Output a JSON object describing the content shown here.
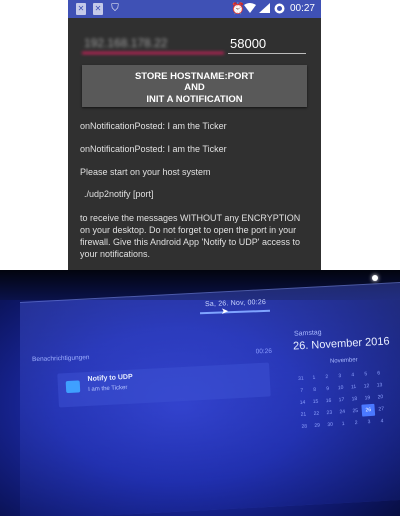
{
  "status_bar": {
    "left_icons": [
      "notification-x-icon",
      "notification-x-icon",
      "shield-icon"
    ],
    "right_icons": [
      "alarm-icon",
      "wifi-icon",
      "signal-icon",
      "battery-icon"
    ],
    "time": "00:27",
    "color": "#3f51b5"
  },
  "form": {
    "host_value": "192.168.178.22",
    "port_value": "58000",
    "button_lines": [
      "STORE HOSTNAME:PORT",
      "AND",
      "INIT A NOTIFICATION"
    ],
    "accent": "#e91e63"
  },
  "log_lines": [
    "onNotificationPosted: I am the Ticker",
    "onNotificationPosted: I am the Ticker",
    "Please start on your host system",
    "./udp2notify [port]",
    "to receive the messages WITHOUT any ENCRYPTION on your desktop. Do not forget to open the port in your firewall. Give this Android App 'Notify to UDP' access to your notifications."
  ],
  "desktop": {
    "clock": "Sa, 26. Nov, 00:26",
    "notifications_header": "Benachrichtigungen",
    "notifications_time": "00:26",
    "notification": {
      "title": "Notify to UDP",
      "body": "I am the Ticker"
    },
    "calendar": {
      "weekday": "Samstag",
      "date": "26. November 2016",
      "month": "November",
      "weeks": [
        [
          "31",
          "1",
          "2",
          "3",
          "4",
          "5",
          "6"
        ],
        [
          "7",
          "8",
          "9",
          "10",
          "11",
          "12",
          "13"
        ],
        [
          "14",
          "15",
          "16",
          "17",
          "18",
          "19",
          "20"
        ],
        [
          "21",
          "22",
          "23",
          "24",
          "25",
          "26",
          "27"
        ],
        [
          "28",
          "29",
          "30",
          "1",
          "2",
          "3",
          "4"
        ]
      ],
      "today": "26"
    }
  }
}
